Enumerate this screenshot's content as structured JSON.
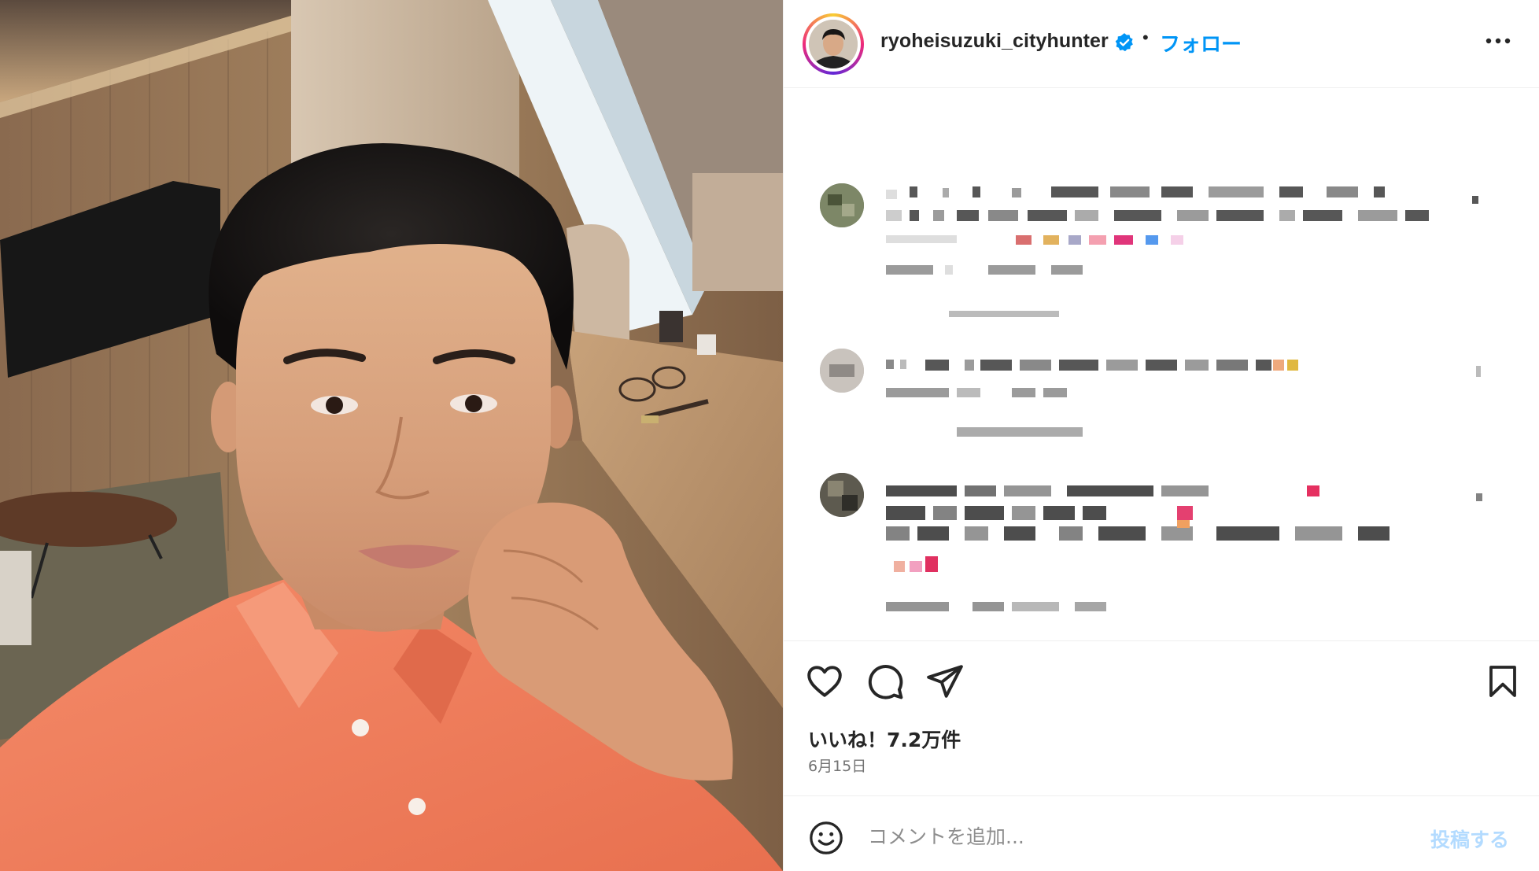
{
  "post": {
    "username": "ryoheisuzuki_cityhunter",
    "verified": true,
    "separator": "•",
    "follow_label": "フォロー",
    "likes_text": "いいね！7.2万件",
    "date_text": "6月15日"
  },
  "composer": {
    "placeholder": "コメントを追加...",
    "post_label": "投稿する"
  },
  "icons": {
    "more": "more-horizontal-icon",
    "like": "heart-icon",
    "comment": "comment-bubble-icon",
    "share": "paper-plane-icon",
    "save": "bookmark-icon",
    "emoji": "smiley-face-icon",
    "verified": "verified-badge-icon"
  },
  "colors": {
    "accent_blue": "#0095f6",
    "post_button_disabled": "#b3dbff",
    "shirt_orange": "#f07f5e"
  }
}
